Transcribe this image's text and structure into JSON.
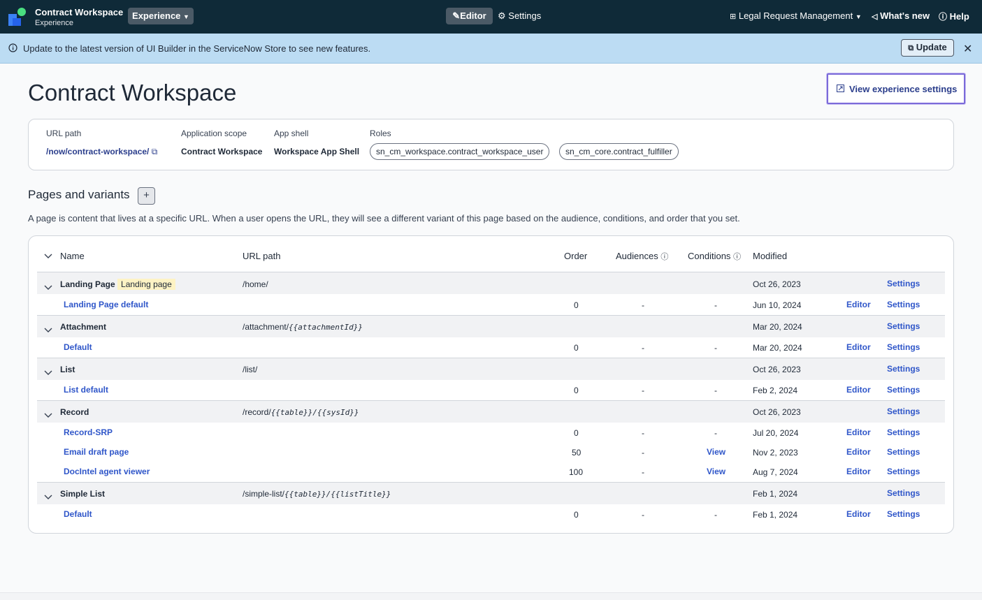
{
  "topbar": {
    "app_title": "Contract Workspace",
    "app_subtitle": "Experience",
    "experience_menu": "Experience",
    "editor_tab": "Editor",
    "settings_tab": "Settings",
    "app_scope_menu": "Legal Request Management",
    "whats_new": "What's new",
    "help": "Help"
  },
  "banner": {
    "message": "Update to the latest version of UI Builder in the ServiceNow Store to see new features.",
    "update_label": "Update"
  },
  "page": {
    "title": "Contract Workspace",
    "view_settings_label": "View experience settings"
  },
  "info": {
    "url_path_label": "URL path",
    "url_path_value": "/now/contract-workspace/",
    "scope_label": "Application scope",
    "scope_value": "Contract Workspace",
    "shell_label": "App shell",
    "shell_value": "Workspace App Shell",
    "roles_label": "Roles",
    "roles": [
      "sn_cm_workspace.contract_workspace_user",
      "sn_cm_core.contract_fulfiller"
    ]
  },
  "pages_section": {
    "title": "Pages and variants",
    "add_label": "+",
    "description": "A page is content that lives at a specific URL. When a user opens the URL, they will see a different variant of this page based on the audience, conditions, and order that you set."
  },
  "table": {
    "columns": {
      "name": "Name",
      "url_path": "URL path",
      "order": "Order",
      "audiences": "Audiences",
      "conditions": "Conditions",
      "modified": "Modified"
    },
    "editor_label": "Editor",
    "settings_label": "Settings",
    "groups": [
      {
        "name": "Landing Page",
        "badge": "Landing page",
        "url": "/home/",
        "modified": "Oct 26, 2023",
        "variants": [
          {
            "name": "Landing Page default",
            "order": "0",
            "audiences": "-",
            "conditions": "-",
            "modified": "Jun 10, 2024"
          }
        ]
      },
      {
        "name": "Attachment",
        "url_prefix": "/attachment/",
        "url_var": "{{attachmentId}}",
        "modified": "Mar 20, 2024",
        "variants": [
          {
            "name": "Default",
            "order": "0",
            "audiences": "-",
            "conditions": "-",
            "modified": "Mar 20, 2024"
          }
        ]
      },
      {
        "name": "List",
        "url": "/list/",
        "modified": "Oct 26, 2023",
        "variants": [
          {
            "name": "List default",
            "order": "0",
            "audiences": "-",
            "conditions": "-",
            "modified": "Feb 2, 2024"
          }
        ]
      },
      {
        "name": "Record",
        "url_prefix": "/record/",
        "url_var": "{{table}}/{{sysId}}",
        "modified": "Oct 26, 2023",
        "variants": [
          {
            "name": "Record-SRP",
            "order": "0",
            "audiences": "-",
            "conditions": "-",
            "modified": "Jul 20, 2024"
          },
          {
            "name": "Email draft page",
            "order": "50",
            "audiences": "-",
            "conditions": "View",
            "modified": "Nov 2, 2023"
          },
          {
            "name": "DocIntel agent viewer",
            "order": "100",
            "audiences": "-",
            "conditions": "View",
            "modified": "Aug 7, 2024"
          }
        ]
      },
      {
        "name": "Simple List",
        "url_prefix": "/simple-list/",
        "url_var": "{{table}}/{{listTitle}}",
        "modified": "Feb 1, 2024",
        "variants": [
          {
            "name": "Default",
            "order": "0",
            "audiences": "-",
            "conditions": "-",
            "modified": "Feb 1, 2024"
          }
        ]
      }
    ]
  },
  "colors": {
    "topbar": "#0f2a38",
    "banner": "#bcdcf3",
    "link": "#2f56c9",
    "focus_ring": "#7b6ad9"
  }
}
